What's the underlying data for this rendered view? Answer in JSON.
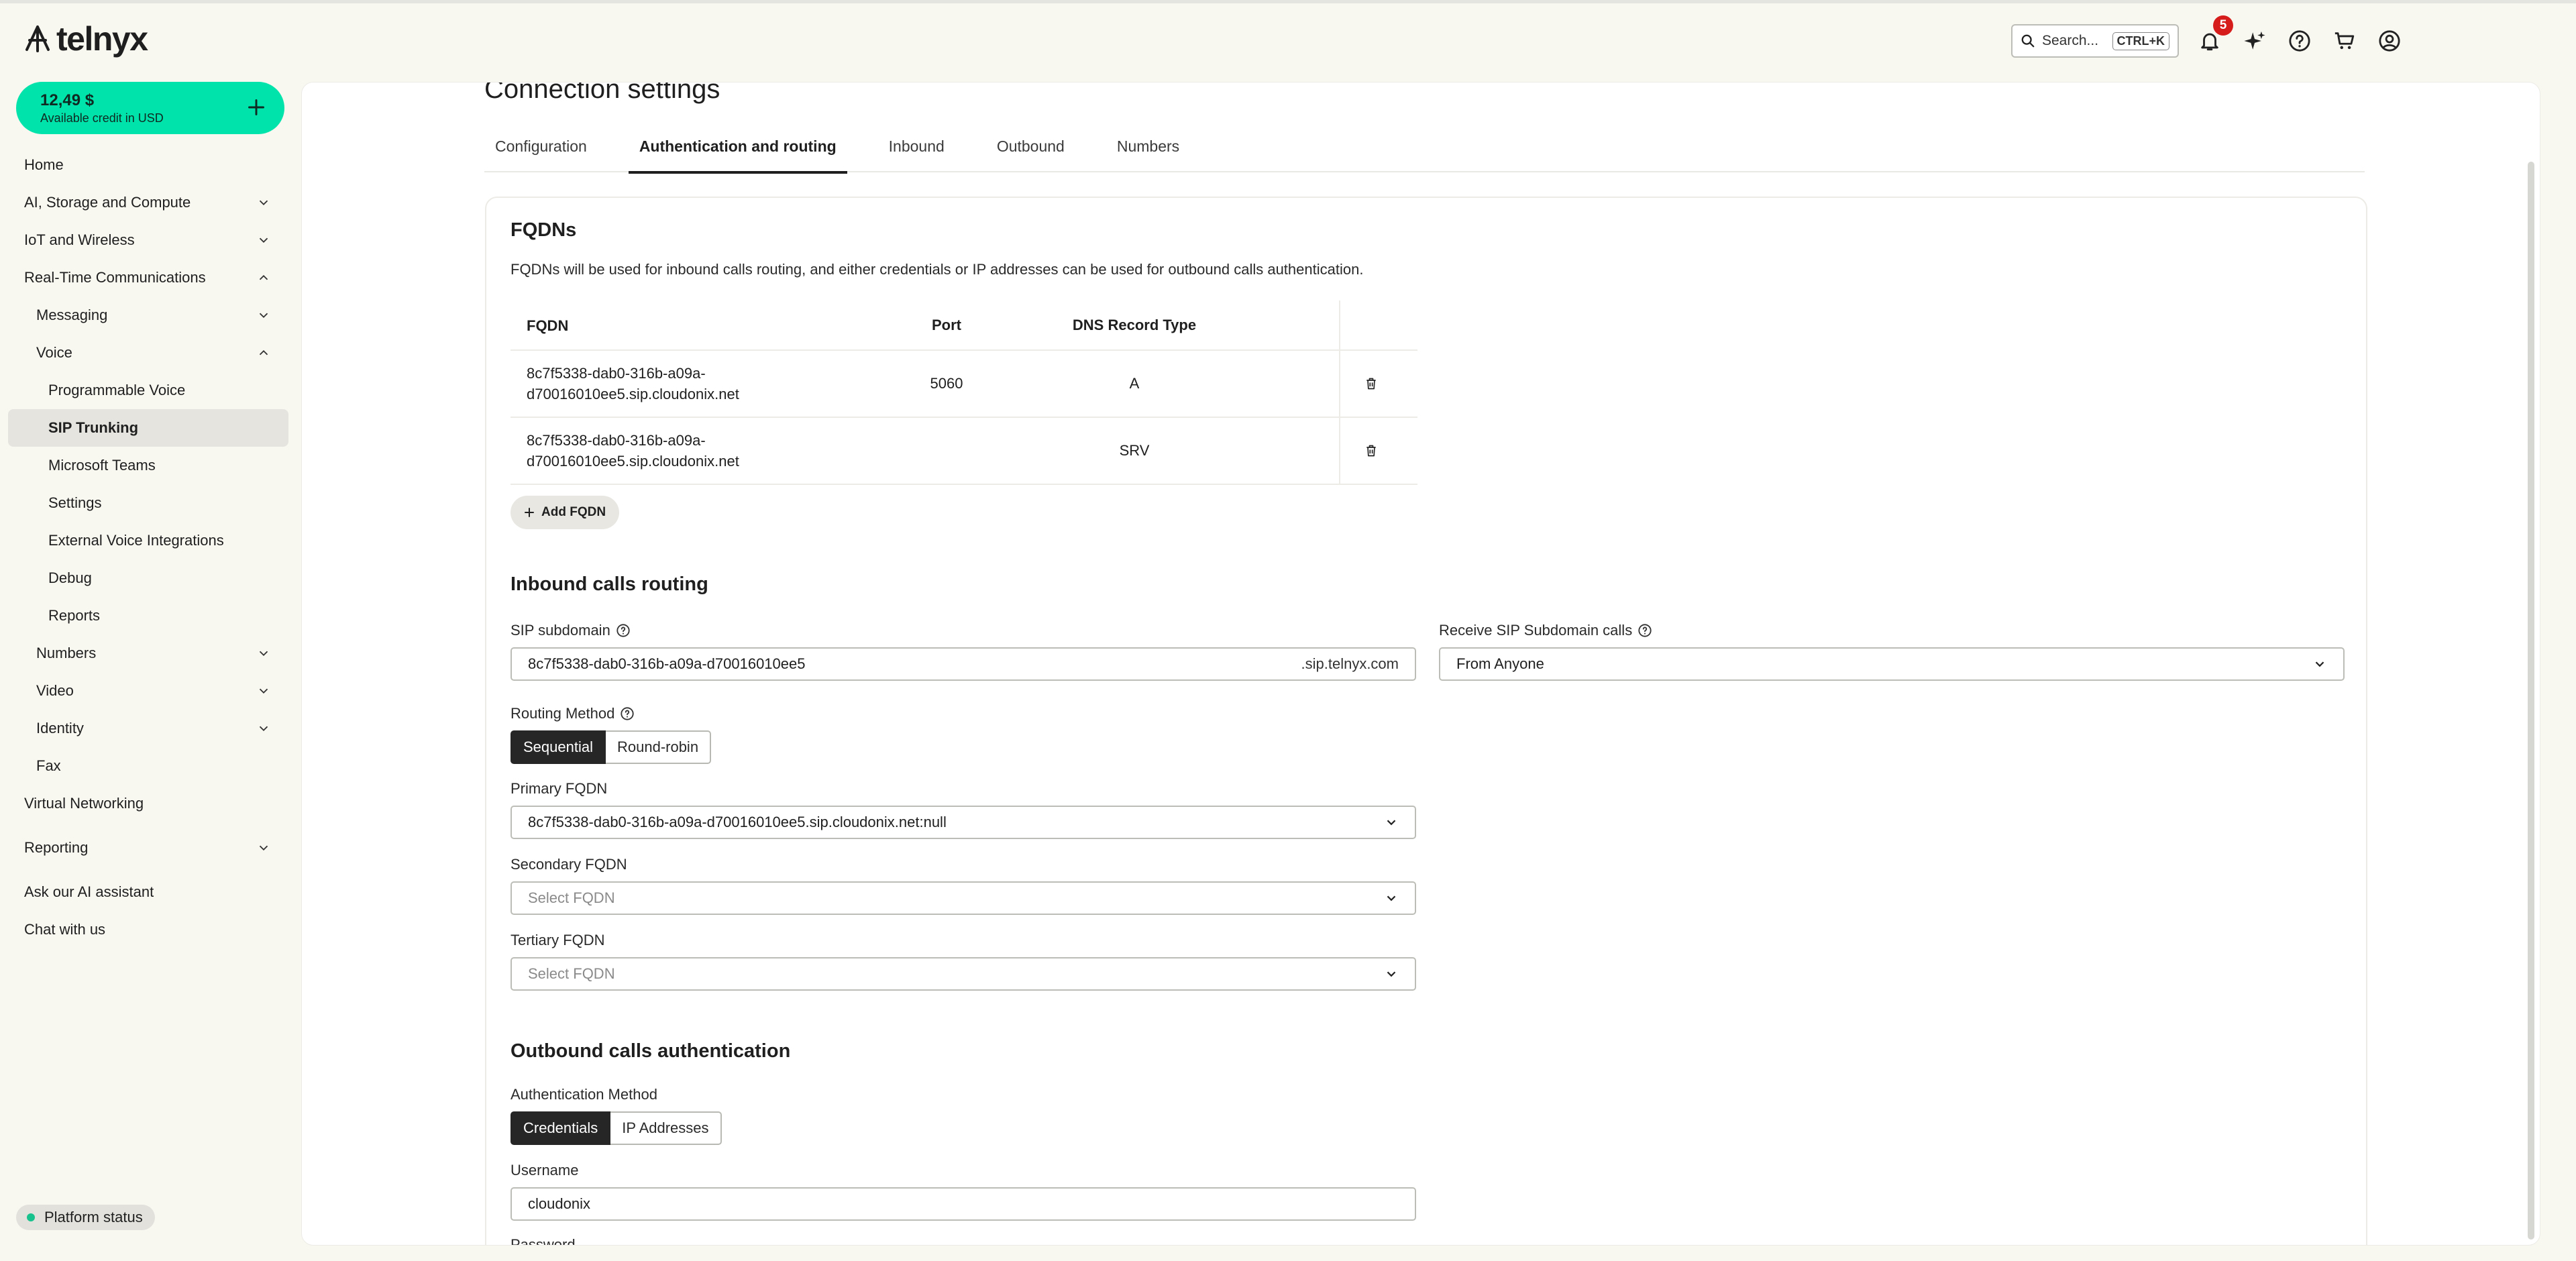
{
  "brand": {
    "name": "telnyx"
  },
  "topbar": {
    "search_label": "Search...",
    "search_shortcut": "CTRL+K",
    "notifications_count": "5"
  },
  "credit": {
    "amount": "12,49 $",
    "label": "Available credit in USD"
  },
  "nav": {
    "home": "Home",
    "ai_storage": "AI, Storage and Compute",
    "iot": "IoT and Wireless",
    "rtc": "Real-Time Communications",
    "messaging": "Messaging",
    "voice": "Voice",
    "programmable_voice": "Programmable Voice",
    "sip_trunking": "SIP Trunking",
    "teams": "Microsoft Teams",
    "settings": "Settings",
    "external_voice": "External Voice Integrations",
    "debug": "Debug",
    "reports": "Reports",
    "numbers": "Numbers",
    "video": "Video",
    "identity": "Identity",
    "fax": "Fax",
    "virtual_networking": "Virtual Networking",
    "reporting": "Reporting",
    "ask_ai": "Ask our AI assistant",
    "chat": "Chat with us"
  },
  "platform_status": "Platform status",
  "page": {
    "title": "Connection settings",
    "tabs": [
      "Configuration",
      "Authentication and routing",
      "Inbound",
      "Outbound",
      "Numbers"
    ]
  },
  "fqdns": {
    "title": "FQDNs",
    "description": "FQDNs will be used for inbound calls routing, and either credentials or IP addresses can be used for outbound calls authentication.",
    "headers": {
      "fqdn": "FQDN",
      "port": "Port",
      "dns": "DNS Record Type"
    },
    "rows": [
      {
        "fqdn_line1": "8c7f5338-dab0-316b-a09a-",
        "fqdn_line2": "d70016010ee5.sip.cloudonix.net",
        "port": "5060",
        "dns": "A"
      },
      {
        "fqdn_line1": "8c7f5338-dab0-316b-a09a-",
        "fqdn_line2": "d70016010ee5.sip.cloudonix.net",
        "port": "",
        "dns": "SRV"
      }
    ],
    "add_label": "Add FQDN"
  },
  "inbound": {
    "title": "Inbound calls routing",
    "sip_subdomain_label": "SIP subdomain",
    "sip_subdomain_value": "8c7f5338-dab0-316b-a09a-d70016010ee5",
    "sip_subdomain_suffix": ".sip.telnyx.com",
    "receive_label": "Receive SIP Subdomain calls",
    "receive_value": "From Anyone",
    "routing_method_label": "Routing Method",
    "routing_options": [
      "Sequential",
      "Round-robin"
    ],
    "primary_label": "Primary FQDN",
    "primary_value": "8c7f5338-dab0-316b-a09a-d70016010ee5.sip.cloudonix.net:null",
    "secondary_label": "Secondary FQDN",
    "secondary_placeholder": "Select FQDN",
    "tertiary_label": "Tertiary FQDN",
    "tertiary_placeholder": "Select FQDN"
  },
  "outbound": {
    "title": "Outbound calls authentication",
    "auth_method_label": "Authentication Method",
    "auth_options": [
      "Credentials",
      "IP Addresses"
    ],
    "username_label": "Username",
    "username_value": "cloudonix",
    "password_label": "Password"
  },
  "colors": {
    "accent": "#00e3aa",
    "badge": "#d71c1c",
    "active_bg": "#262626",
    "sidebar_active": "#e5e4de"
  }
}
